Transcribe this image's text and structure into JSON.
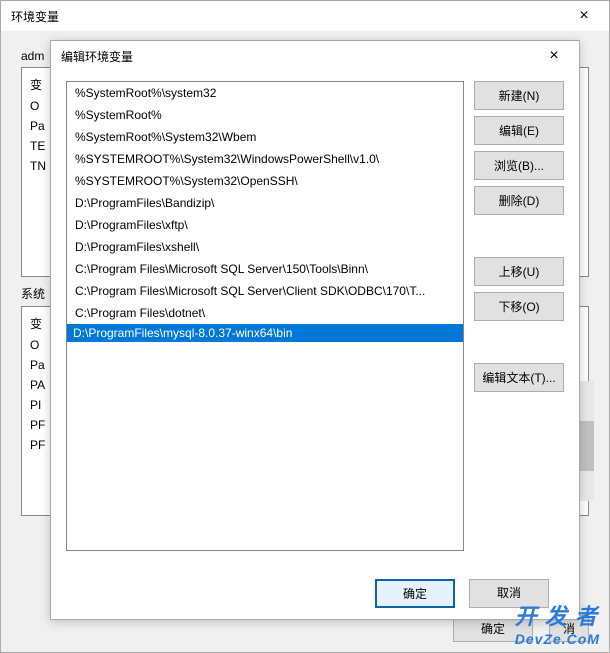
{
  "parent_window": {
    "title": "环境变量",
    "user_section_label": "adm",
    "user_rows": [
      "变",
      "O",
      "Pa",
      "TE",
      "TN"
    ],
    "system_section_label": "系统",
    "system_rows": [
      "变",
      "O",
      "Pa",
      "PA",
      "PI",
      "PF",
      "PF"
    ],
    "ok_label": "确定",
    "cancel_partial": "消"
  },
  "dialog": {
    "title": "编辑环境变量",
    "items": [
      {
        "text": "%SystemRoot%\\system32",
        "selected": false,
        "highlighted": false
      },
      {
        "text": "%SystemRoot%",
        "selected": false,
        "highlighted": false
      },
      {
        "text": "%SystemRoot%\\System32\\Wbem",
        "selected": false,
        "highlighted": false
      },
      {
        "text": "%SYSTEMROOT%\\System32\\WindowsPowerShell\\v1.0\\",
        "selected": false,
        "highlighted": false
      },
      {
        "text": "%SYSTEMROOT%\\System32\\OpenSSH\\",
        "selected": false,
        "highlighted": false
      },
      {
        "text": "D:\\ProgramFiles\\Bandizip\\",
        "selected": false,
        "highlighted": false
      },
      {
        "text": "D:\\ProgramFiles\\xftp\\",
        "selected": false,
        "highlighted": false
      },
      {
        "text": "D:\\ProgramFiles\\xshell\\",
        "selected": false,
        "highlighted": false
      },
      {
        "text": "C:\\Program Files\\Microsoft SQL Server\\150\\Tools\\Binn\\",
        "selected": false,
        "highlighted": false
      },
      {
        "text": "C:\\Program Files\\Microsoft SQL Server\\Client SDK\\ODBC\\170\\T...",
        "selected": false,
        "highlighted": false
      },
      {
        "text": "C:\\Program Files\\dotnet\\",
        "selected": false,
        "highlighted": false
      },
      {
        "text": "D:\\ProgramFiles\\mysql-8.0.37-winx64\\bin",
        "selected": true,
        "highlighted": true
      }
    ],
    "buttons": {
      "new": "新建(N)",
      "edit": "编辑(E)",
      "browse": "浏览(B)...",
      "delete": "删除(D)",
      "moveup": "上移(U)",
      "movedown": "下移(O)",
      "edittext": "编辑文本(T)..."
    },
    "ok": "确定",
    "cancel": "取消"
  },
  "watermark": {
    "line1": "开 发 者",
    "line2": "DevZe.CoM"
  }
}
